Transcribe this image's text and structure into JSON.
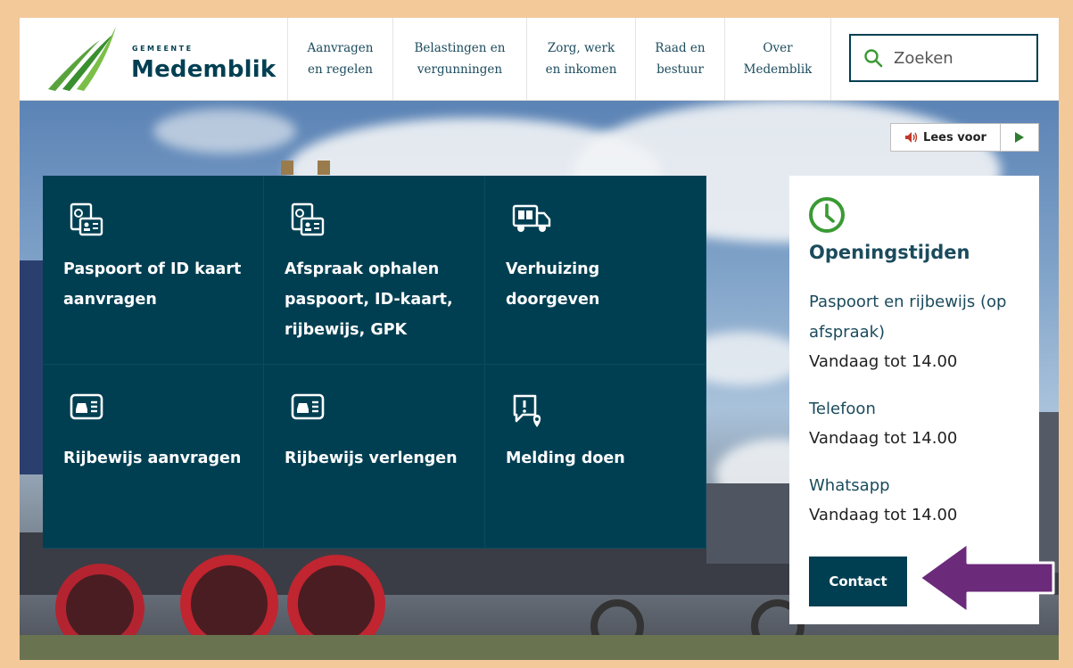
{
  "logo": {
    "small": "GEMEENTE",
    "name": "Medemblik"
  },
  "nav": [
    {
      "line1": "Aanvragen",
      "line2": "en regelen"
    },
    {
      "line1": "Belastingen en",
      "line2": "vergunningen"
    },
    {
      "line1": "Zorg, werk",
      "line2": "en inkomen"
    },
    {
      "line1": "Raad en",
      "line2": "bestuur"
    },
    {
      "line1": "Over",
      "line2": "Medemblik"
    }
  ],
  "search": {
    "placeholder": "Zoeken",
    "icon": "search-icon"
  },
  "listen": {
    "label": "Lees voor",
    "icon": "speaker-icon",
    "play_icon": "play-icon"
  },
  "tiles": [
    {
      "icon": "id-card-document-icon",
      "lines": [
        "Paspoort of ID kaart",
        "aanvragen"
      ]
    },
    {
      "icon": "id-card-document-icon",
      "lines": [
        "Afspraak ophalen",
        "paspoort, ID-kaart,",
        "rijbewijs, GPK"
      ]
    },
    {
      "icon": "moving-truck-icon",
      "lines": [
        "Verhuizing",
        "doorgeven"
      ]
    },
    {
      "icon": "drivers-license-icon",
      "lines": [
        "Rijbewijs aanvragen"
      ]
    },
    {
      "icon": "drivers-license-icon",
      "lines": [
        "Rijbewijs verlengen"
      ]
    },
    {
      "icon": "report-location-icon",
      "lines": [
        "Melding doen"
      ]
    }
  ],
  "opening": {
    "icon": "clock-icon",
    "title": "Openingstijden",
    "items": [
      {
        "line1": "Paspoort en rijbewijs (op",
        "line2": "afspraak)",
        "value": "Vandaag tot 14.00"
      },
      {
        "line1": "Telefoon",
        "value": "Vandaag tot 14.00"
      },
      {
        "line1": "Whatsapp",
        "value": "Vandaag tot 14.00"
      }
    ],
    "contact_label": "Contact"
  },
  "colors": {
    "primary": "#003f52",
    "accent_green": "#3a9a34",
    "frame": "#f3c99a",
    "annotation_arrow": "#6b2a7a"
  }
}
